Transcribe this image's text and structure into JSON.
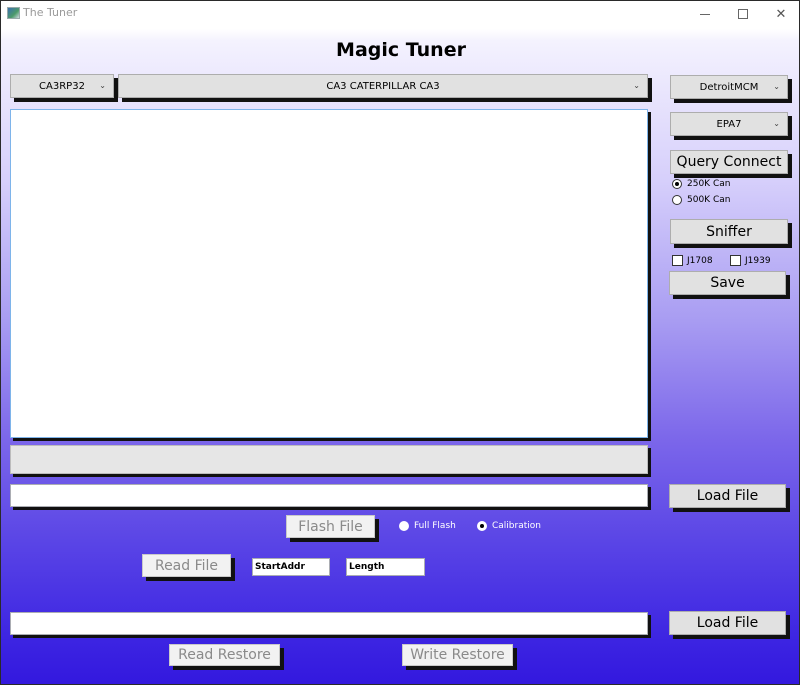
{
  "window": {
    "title": "The Tuner",
    "controls": {
      "minimize": "minimize",
      "maximize": "maximize",
      "close": "close"
    }
  },
  "header": {
    "title": "Magic Tuner"
  },
  "selectors": {
    "module": {
      "value": "CA3RP32"
    },
    "engine": {
      "value": "CA3 CATERPILLAR CA3"
    },
    "ecu": {
      "value": "DetroitMCM"
    },
    "emissions": {
      "value": "EPA7"
    }
  },
  "main": {
    "log_text": "",
    "progress_percent": 0
  },
  "connection": {
    "query_connect_label": "Query Connect",
    "can_speed_options": [
      {
        "label": "250K Can",
        "selected": true
      },
      {
        "label": "500K Can",
        "selected": false
      }
    ],
    "sniffer_label": "Sniffer",
    "protocols": [
      {
        "label": "J1708",
        "checked": false
      },
      {
        "label": "J1939",
        "checked": false
      }
    ],
    "save_label": "Save"
  },
  "flash": {
    "file_path": "",
    "load_file_label": "Load File",
    "flash_file_label": "Flash File",
    "mode_options": [
      {
        "label": "Full Flash",
        "selected": false
      },
      {
        "label": "Calibration",
        "selected": true
      }
    ],
    "read_file_label": "Read File",
    "start_addr": "StartAddr",
    "length": "Length"
  },
  "restore": {
    "file_path": "",
    "load_file_label": "Load File",
    "read_restore_label": "Read Restore",
    "write_restore_label": "Write Restore"
  }
}
